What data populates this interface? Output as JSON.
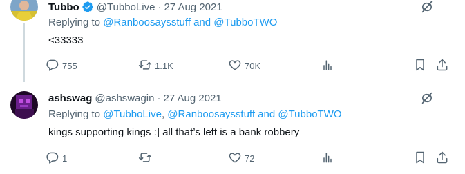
{
  "tweets": [
    {
      "display_name": "Tubbo",
      "verified": true,
      "handle": "@TubboLive",
      "separator": "·",
      "date": "27 Aug 2021",
      "reply_prefix": "Replying to",
      "reply_targets": "@Ranboosaysstuff and @TubboTWO",
      "text": "<33333",
      "replies": "755",
      "retweets": "1.1K",
      "likes": "70K",
      "avatar_colors": [
        "#d6c033",
        "#7ea5c8"
      ]
    },
    {
      "display_name": "ashswag",
      "verified": false,
      "handle": "@ashswagin",
      "separator": "·",
      "date": "27 Aug 2021",
      "reply_prefix": "Replying to",
      "reply_target_1": "@TubboLive",
      "reply_comma": ",",
      "reply_targets": "@Ranboosaysstuff and @TubboTWO",
      "text": "kings supporting kings :] all that’s left is a bank robbery",
      "replies": "1",
      "retweets": "",
      "likes": "72",
      "avatar_colors": [
        "#2a0a33",
        "#8a2bb0"
      ]
    }
  ],
  "colors": {
    "primary_text": "#0f1419",
    "secondary_text": "#536471",
    "link": "#1d9bf0",
    "verified_badge": "#1d9bf0"
  },
  "icons": [
    "grok-icon",
    "reply-icon",
    "retweet-icon",
    "like-icon",
    "views-icon",
    "bookmark-icon",
    "share-icon",
    "verified-badge-icon"
  ]
}
